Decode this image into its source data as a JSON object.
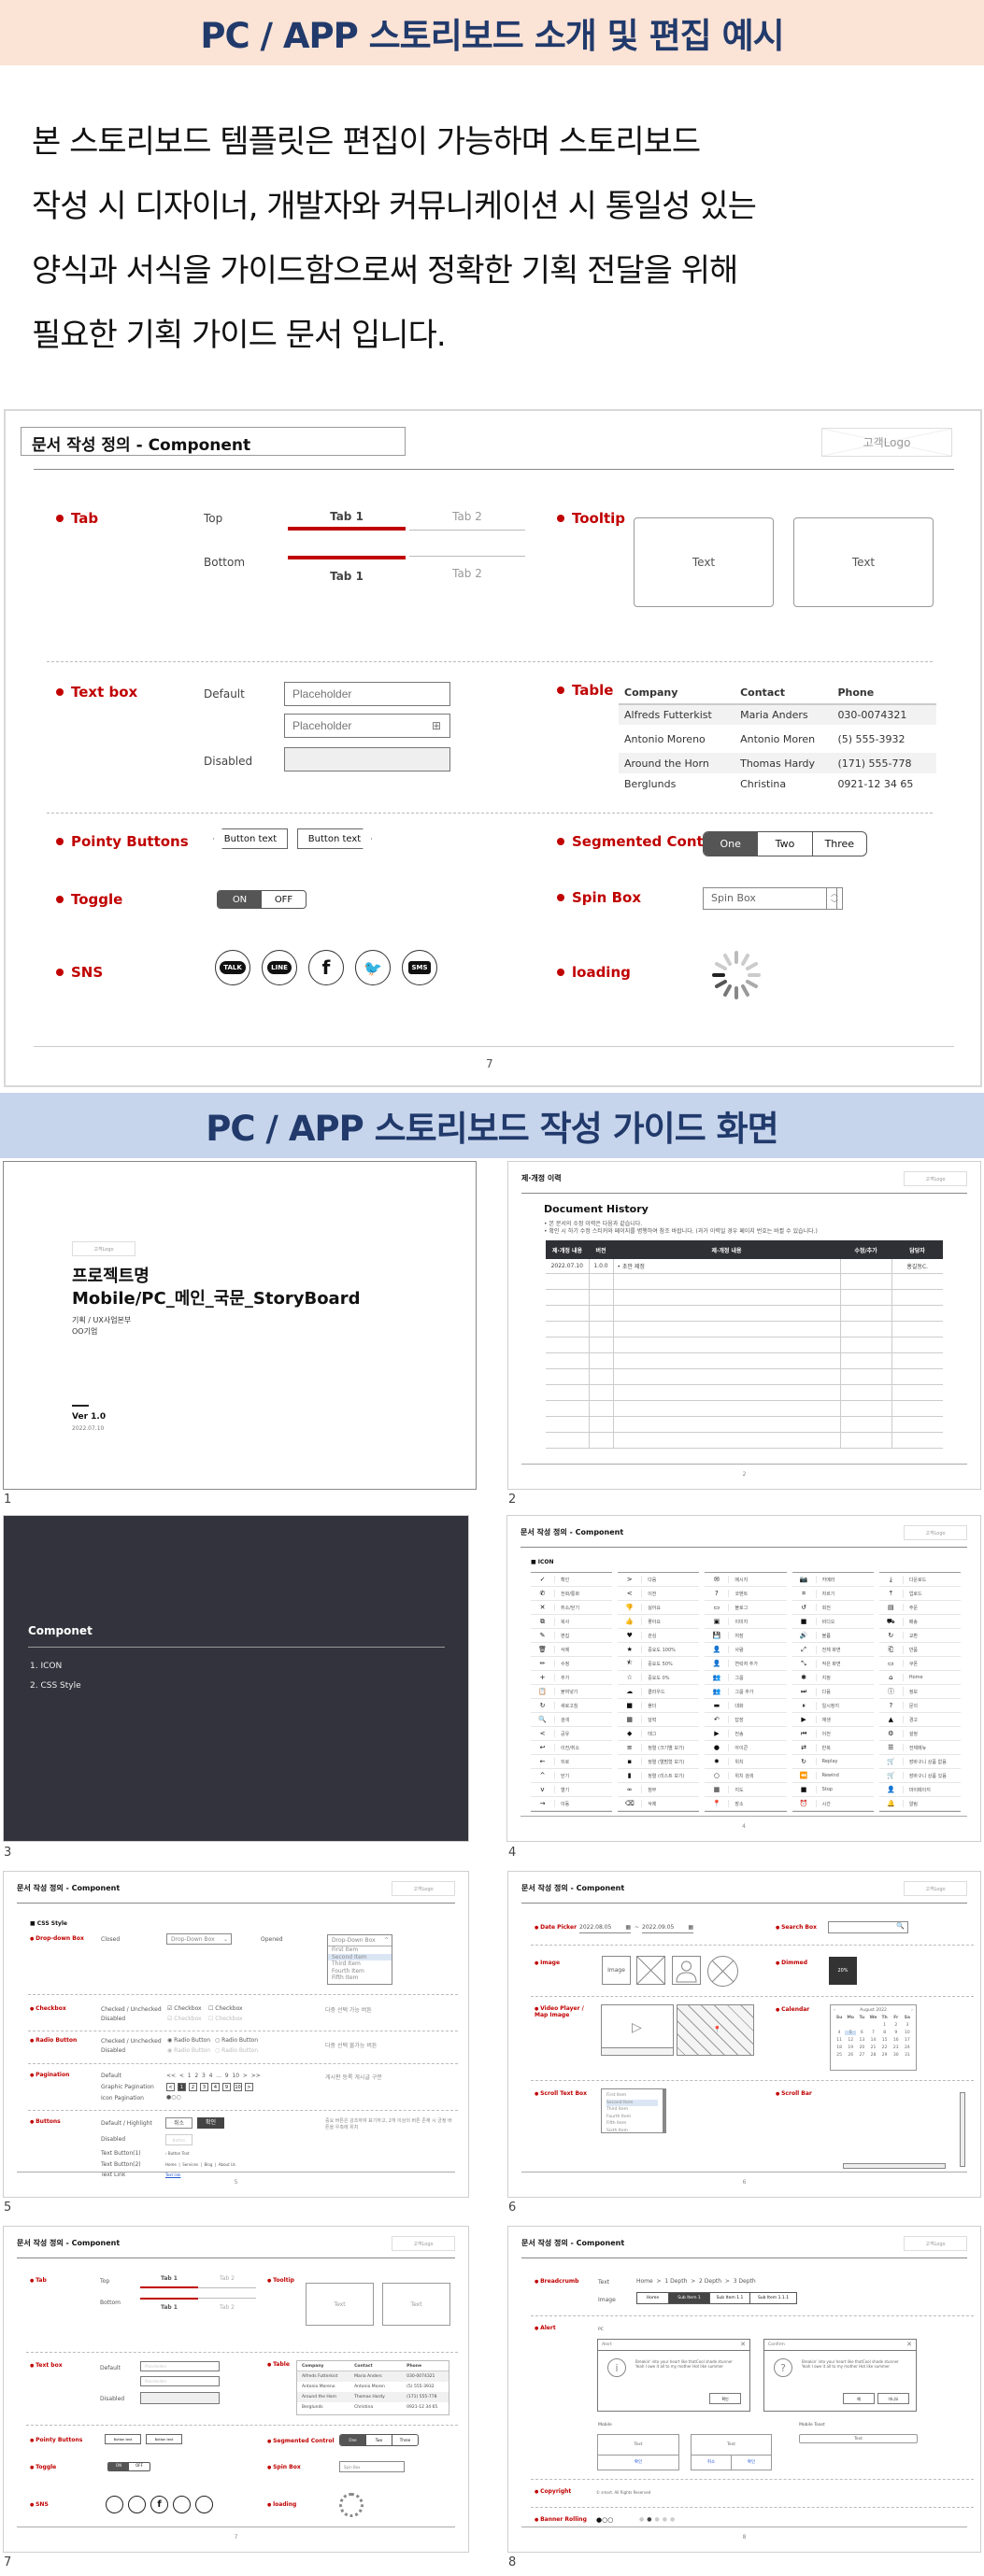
{
  "banner_top": {
    "title": "PC / APP 스토리보드 소개 및 편집 예시",
    "bg": "#fbe3d6",
    "color": "#213a6b"
  },
  "intro": {
    "lines": [
      "본 스토리보드 템플릿은 편집이 가능하며 스토리보드",
      "작성 시 디자이너, 개발자와 커뮤니케이션 시 통일성 있는",
      "양식과 서식을 가이드함으로써 정확한 기획 전달을 위해",
      "필요한 기획 가이드 문서 입니다."
    ]
  },
  "edit_slide": {
    "title": "문서 작성 정의 - Component",
    "logo": "고객Logo",
    "page": "7",
    "labels": {
      "tab": "Tab",
      "tooltip": "Tooltip",
      "textbox": "Text box",
      "table": "Table",
      "pointy": "Pointy Buttons",
      "segmented": "Segmented Control",
      "toggle": "Toggle",
      "spin": "Spin Box",
      "sns": "SNS",
      "loading": "loading"
    },
    "tab": {
      "top": "Top",
      "bottom": "Bottom",
      "tab1": "Tab 1",
      "tab2": "Tab 2"
    },
    "tooltip": {
      "text": "Text"
    },
    "textbox": {
      "default": "Default",
      "disabled": "Disabled",
      "placeholder": "Placeholder"
    },
    "table": {
      "headers": [
        "Company",
        "Contact",
        "Phone"
      ],
      "rows": [
        [
          "Alfreds Futterkist",
          "Maria Anders",
          "030-0074321"
        ],
        [
          "Antonio Moreno",
          "Antonio Moren",
          "(5) 555-3932"
        ],
        [
          "Around the Horn",
          "Thomas Hardy",
          "(171) 555-778"
        ],
        [
          "Berglunds",
          "Christina",
          "0921-12 34 65"
        ]
      ]
    },
    "pointy": {
      "left": "Button text",
      "right": "Button text"
    },
    "segmented": {
      "options": [
        "One",
        "Two",
        "Three"
      ],
      "selected": "One"
    },
    "toggle": {
      "on": "ON",
      "off": "OFF",
      "state": "ON"
    },
    "spin": {
      "value": "Spin Box"
    },
    "sns": [
      "TALK",
      "LINE",
      "f",
      "twitter",
      "SMS"
    ]
  },
  "banner_guide": {
    "title": "PC / APP 스토리보드 작성 가이드 화면",
    "bg": "#c7d5ec",
    "color": "#213a6b"
  },
  "thumbnails": {
    "s1": {
      "num": "1",
      "logo": "고객Logo",
      "title1": "프로젝트명",
      "title2": "Mobile/PC_메인_국문_StoryBoard",
      "dept": "기획 / UX사업본부",
      "company": "OO기업",
      "ver": "Ver 1.0",
      "date": "2022.07.10"
    },
    "s2": {
      "num": "2",
      "title": "제·개정 이력",
      "logo": "고객Logo",
      "heading": "Document History",
      "bullets": [
        "본 문서의 수정 이력은 다음과 같습니다.",
        "확인 시 하기 수정 스티커와 페이지를 병행하여 참조 바랍니다. (과거 이력일 경우 페이지 번호는 바뀔 수 있습니다.)"
      ],
      "headers": [
        "제·개정 내용",
        "버전",
        "제·개정 내용",
        "수정/추가",
        "담당자"
      ],
      "rows": [
        [
          "2022.07.10",
          "1.0.0",
          "• 초안 제정",
          "",
          "홍길동C."
        ]
      ],
      "page": "2"
    },
    "s3": {
      "num": "3",
      "title": "Componet",
      "items": [
        "1.  ICON",
        "2.  CSS Style"
      ]
    },
    "s4": {
      "num": "4",
      "title": "문서 작성 정의 - Component",
      "logo": "고객Logo",
      "section": "ICON",
      "page": "4",
      "columns": [
        [
          [
            "✓",
            "확인"
          ],
          [
            "✆",
            "전화/통화"
          ],
          [
            "✕",
            "취소/닫기"
          ],
          [
            "⧉",
            "복사"
          ],
          [
            "✎",
            "편집"
          ],
          [
            "🗑",
            "삭제"
          ],
          [
            "✏",
            "수정"
          ],
          [
            "+",
            "추가"
          ],
          [
            "📋",
            "붙여넣기"
          ],
          [
            "↻",
            "새로고침"
          ],
          [
            "🔍",
            "검색"
          ],
          [
            "<",
            "공유"
          ],
          [
            "↩",
            "이전/취소"
          ],
          [
            "←",
            "뒤로"
          ],
          [
            "^",
            "닫기"
          ],
          [
            "v",
            "열기"
          ],
          [
            "→",
            "이동"
          ]
        ],
        [
          [
            ">",
            "다음"
          ],
          [
            "<",
            "이전"
          ],
          [
            "👎",
            "싫어요"
          ],
          [
            "👍",
            "좋아요"
          ],
          [
            "♥",
            "관심"
          ],
          [
            "★",
            "중요도 100%"
          ],
          [
            "⯪",
            "중요도 50%"
          ],
          [
            "☆",
            "중요도 0%"
          ],
          [
            "☁",
            "클라우드"
          ],
          [
            "■",
            "폴더"
          ],
          [
            "▦",
            "달력"
          ],
          [
            "◆",
            "태그"
          ],
          [
            "≡",
            "정렬 (크기별 보기)"
          ],
          [
            "▪",
            "정렬 (앨범형 보기)"
          ],
          [
            "▮",
            "정렬 (리스트 보기)"
          ],
          [
            "∞",
            "첨부"
          ],
          [
            "⌫",
            "삭제"
          ]
        ],
        [
          [
            "✉",
            "메시지"
          ],
          [
            "?",
            "코멘트"
          ],
          [
            "▭",
            "블로그"
          ],
          [
            "▣",
            "이미지"
          ],
          [
            "💾",
            "저장"
          ],
          [
            "👤",
            "사람"
          ],
          [
            "👤",
            "연락처 추가"
          ],
          [
            "👥",
            "그룹"
          ],
          [
            "👥",
            "그룹 추가"
          ],
          [
            "▬",
            "대화"
          ],
          [
            "↶",
            "답장"
          ],
          [
            "▶",
            "전송"
          ],
          [
            "●",
            "아이콘"
          ],
          [
            "✹",
            "위치"
          ],
          [
            "○",
            "위치 검색"
          ],
          [
            "▦",
            "지도"
          ],
          [
            "📍",
            "장소"
          ]
        ],
        [
          [
            "📷",
            "카메라"
          ],
          [
            "⌗",
            "자르기"
          ],
          [
            "↺",
            "회전"
          ],
          [
            "■",
            "비디오"
          ],
          [
            "🔊",
            "볼륨"
          ],
          [
            "⤢",
            "전체 화면"
          ],
          [
            "⤡",
            "작은 화면"
          ],
          [
            "✱",
            "지정"
          ],
          [
            "⏭",
            "다음"
          ],
          [
            "⏸",
            "일시정지"
          ],
          [
            "▶",
            "재생"
          ],
          [
            "⏮",
            "이전"
          ],
          [
            "⇄",
            "반복"
          ],
          [
            "↻",
            "Replay"
          ],
          [
            "⏪",
            "Rewind"
          ],
          [
            "■",
            "Stop"
          ],
          [
            "⏰",
            "시간"
          ]
        ],
        [
          [
            "⤓",
            "다운로드"
          ],
          [
            "⤒",
            "업로드"
          ],
          [
            "▤",
            "주문"
          ],
          [
            "⛟",
            "배송"
          ],
          [
            "↻",
            "교환"
          ],
          [
            "⎗",
            "반품"
          ],
          [
            "▭",
            "쿠폰"
          ],
          [
            "⌂",
            "Home"
          ],
          [
            "ⓘ",
            "정보"
          ],
          [
            "?",
            "문의"
          ],
          [
            "▲",
            "경고"
          ],
          [
            "⚙",
            "설정"
          ],
          [
            "☰",
            "전체메뉴"
          ],
          [
            "🛒",
            "장바구니 상품 없음"
          ],
          [
            "🛒",
            "장바구니 상품 있음"
          ],
          [
            "👤",
            "마이페이지"
          ],
          [
            "🔔",
            "알림"
          ]
        ]
      ]
    },
    "s5": {
      "num": "5",
      "title": "문서 작성 정의 - Component",
      "logo": "고객Logo",
      "section": "CSS Style",
      "page": "5",
      "dropdown": {
        "label": "Drop-down Box",
        "closed": "Closed",
        "opened": "Opened",
        "value": "Drop-Down Box",
        "items": [
          "First Item",
          "Second Item",
          "Third Item",
          "Fourth Item",
          "Fifth Item"
        ],
        "highlighted": "Second Item"
      },
      "checkbox": {
        "label": "Checkbox",
        "state": "Checked / Unchecked",
        "disabled": "Disabled",
        "item": "Checkbox",
        "note": "다중 선택 가능 버튼"
      },
      "radio": {
        "label": "Radio Button",
        "state": "Checked / Unchecked",
        "disabled": "Disabled",
        "item": "Radio Button",
        "note": "다중 선택 불가능 버튼"
      },
      "pagination": {
        "label": "Pagination",
        "default": "Default",
        "graphic": "Graphic Pagination",
        "icon": "Icon Pagination",
        "seq": "<<  <  1  2  3  4  ...  9  10  >  >>",
        "pages": [
          "1",
          "2",
          "3",
          "4",
          "9",
          "10"
        ],
        "note": "게시판 등록 게시글 구분"
      },
      "buttons": {
        "label": "Buttons",
        "dh": "Default / Highlight",
        "disabled": "Disabled",
        "tb1": "Text Button(1)",
        "tb2": "Text Button(2)",
        "tl": "Text Link",
        "cancel": "취소",
        "ok": "확인",
        "btn": "Button",
        "btntext": "› Button Text",
        "links": "Home  |  Services  |  Blog  |  About Us",
        "link": "Text link",
        "note": "중요 버튼은 강조하여 표기하고, 2개 이상의 버튼 존재 시 긍정 버튼을 우측에 위치"
      }
    },
    "s6": {
      "num": "6",
      "title": "문서 작성 정의 - Component",
      "logo": "고객Logo",
      "page": "6",
      "labels": {
        "date": "Date Picker",
        "search": "Search Box",
        "image": "Image",
        "dimmed": "Dimmed",
        "video": "Video Player / Map Image",
        "calendar": "Calendar",
        "scrolltext": "Scroll Text Box",
        "scrollbar": "Scroll Bar"
      },
      "date_from": "2022.08.05",
      "date_to": "2022.09.05",
      "image_text": "Image",
      "dimmed_text": "20%",
      "calendar": {
        "month": "August 2022",
        "days": [
          "Su",
          "Mo",
          "Tu",
          "We",
          "Th",
          "Fr",
          "Sa"
        ],
        "selected": "5",
        "weeks": [
          [
            "",
            "",
            "",
            "",
            "1",
            "2",
            "3"
          ],
          [
            "4",
            "5",
            "6",
            "7",
            "8",
            "9",
            "10"
          ],
          [
            "11",
            "12",
            "13",
            "14",
            "15",
            "16",
            "17"
          ],
          [
            "18",
            "19",
            "20",
            "21",
            "22",
            "23",
            "24"
          ],
          [
            "25",
            "26",
            "27",
            "28",
            "29",
            "30",
            "31"
          ]
        ]
      },
      "scroll_items": [
        "First Item",
        "Second Item",
        "Third Item",
        "Fourth Item",
        "Fifth Item",
        "Sixth Item"
      ]
    },
    "s7": {
      "num": "7",
      "title": "문서 작성 정의 - Component",
      "logo": "고객Logo",
      "page": "7"
    },
    "s8": {
      "num": "8",
      "title": "문서 작성 정의 - Component",
      "logo": "고객Logo",
      "page": "8",
      "labels": {
        "breadcrumb": "Breadcrumb",
        "alert": "Alert",
        "copyright": "Copyright",
        "banner": "Banner Rolling"
      },
      "bc_text_lbl": "Text",
      "bc_image_lbl": "Image",
      "bc_text": "Home  >  1 Depth  >  2 Depth  >  3 Depth",
      "bc_items": [
        "Home",
        "Sub Item 1",
        "Sub Item 1.1",
        "Sub Item 1.1.1"
      ],
      "pc": "PC",
      "alert_title": "Alert",
      "confirm_title": "Confirm",
      "alert_msg": "Breakin' into your heart like thatCool shade stunner Yeah I owe it all to my mother Hot like summer",
      "ok": "확인",
      "yes": "예",
      "no": "아니오",
      "mobile": "Mobile",
      "toast": "Mobile Toast",
      "text": "Text",
      "cancel": "취소",
      "copyright_text": "© smart. All Rights Reserved"
    }
  }
}
